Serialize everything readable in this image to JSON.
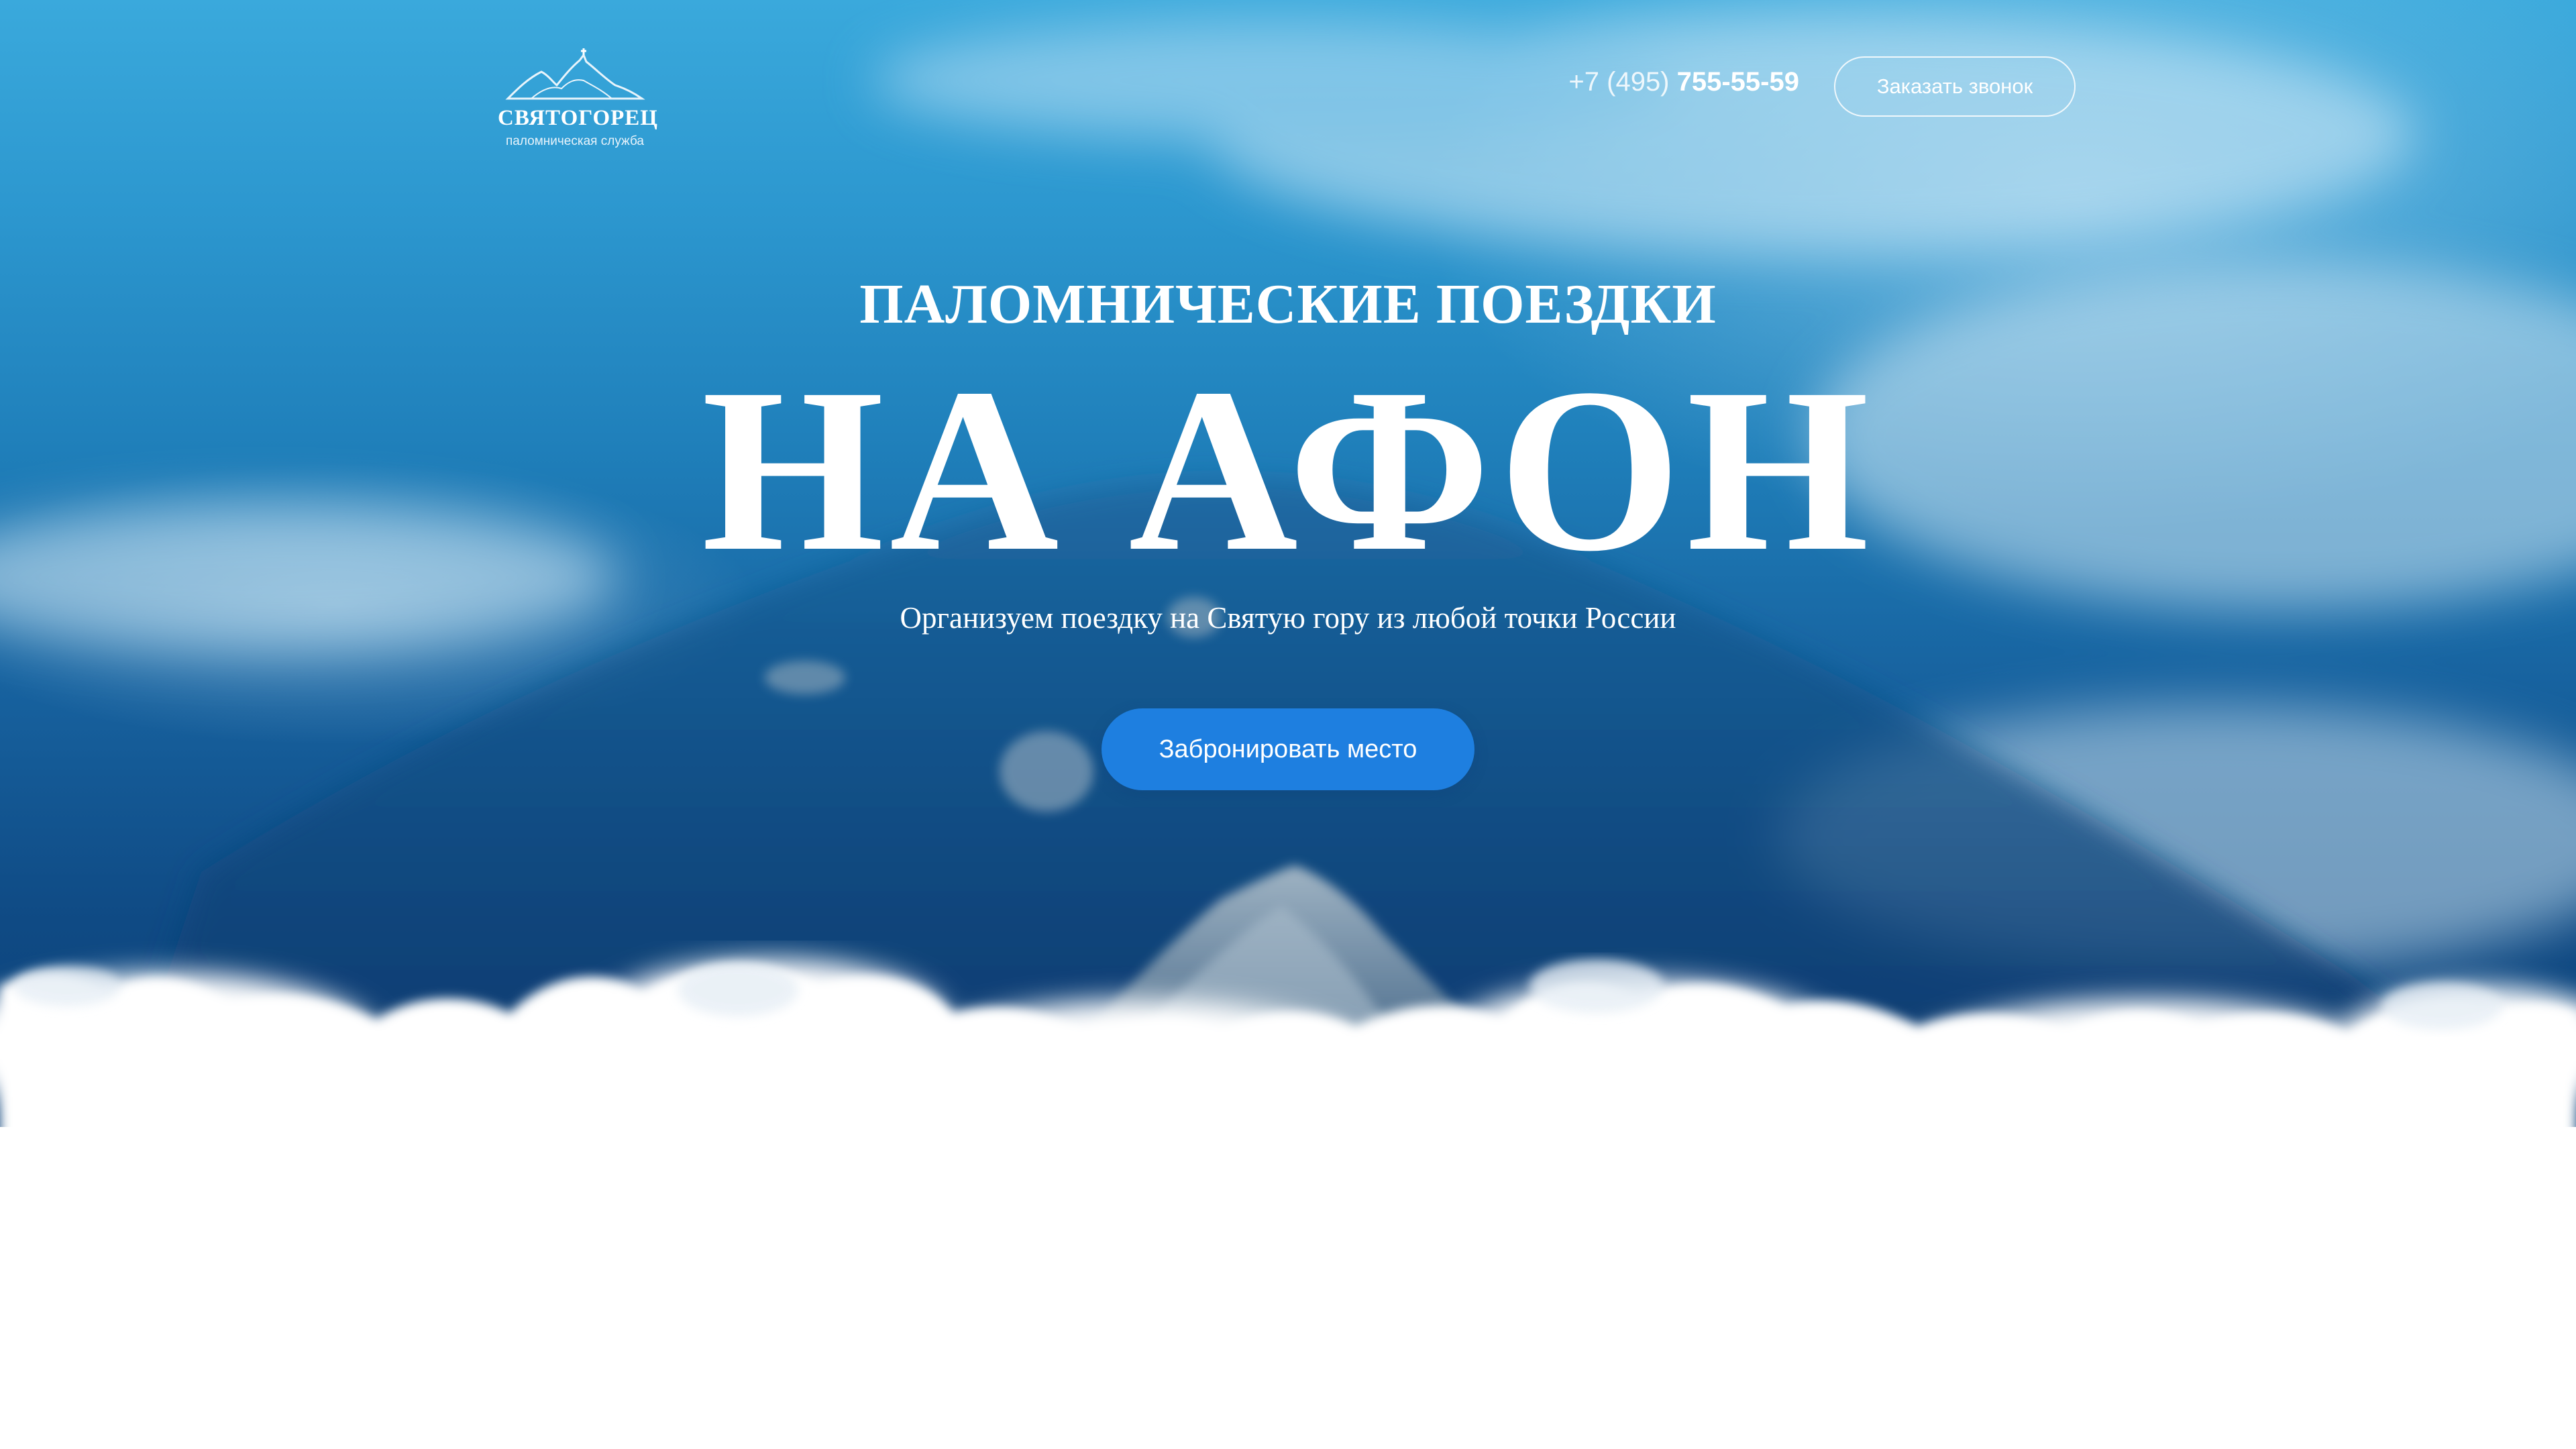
{
  "header": {
    "logo": {
      "title": "СВЯТОГОРЕЦ",
      "subtitle": "паломническая служба",
      "icon": "mountain-logo-icon"
    },
    "phone": {
      "prefix": "+7 (495) ",
      "number": "755-55-59"
    },
    "callback_label": "Заказать звонок"
  },
  "hero": {
    "pretitle": "ПАЛОМНИЧЕСКИЕ ПОЕЗДКИ",
    "title": "НА АФОН",
    "subtitle": "Организуем поездку на Святую гору из любой точки России",
    "cta_label": "Забронировать место"
  },
  "colors": {
    "accent_button": "#1e7fe0",
    "sky_top": "#3aa9dc",
    "sky_bottom": "#0c3f75",
    "page_background": "#ffffff"
  }
}
